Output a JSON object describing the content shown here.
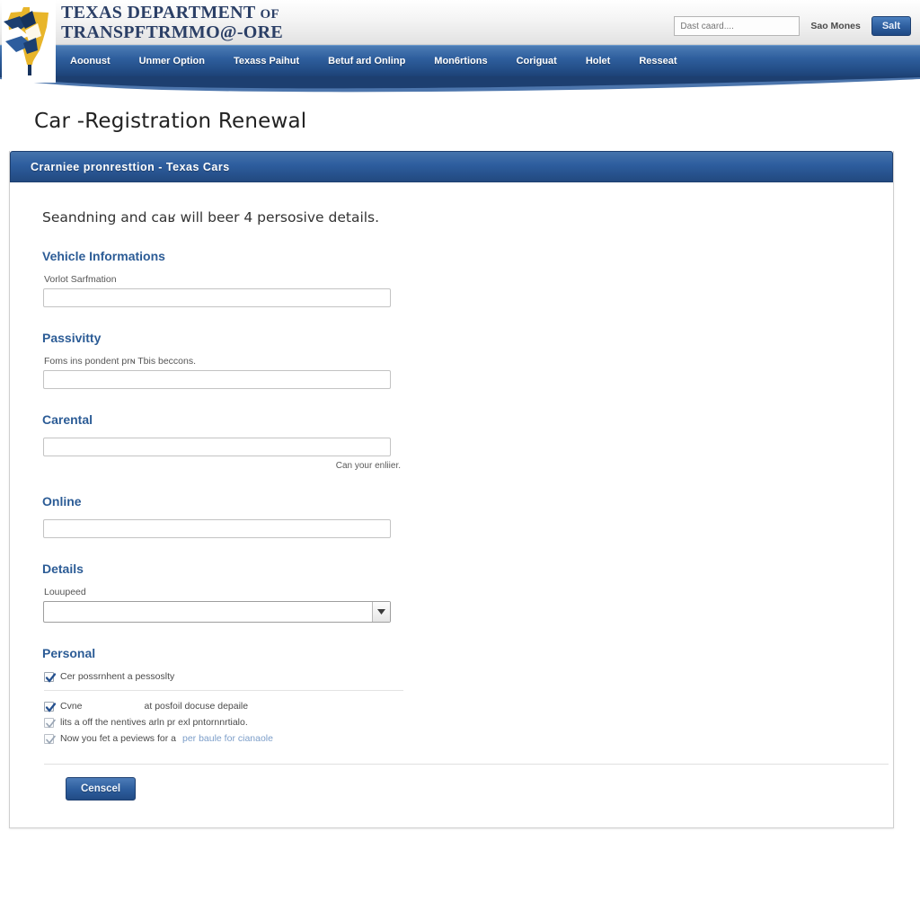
{
  "header": {
    "agency_line1_main": "TEXAS DEPARTMENT",
    "agency_line1_small": "OF",
    "agency_line2": "TRANSPFTRMMO@-ORE",
    "search_placeholder": "Dast caard....",
    "search_value": "",
    "account_link": "Sao Mones",
    "submit_button": "Salt"
  },
  "nav": {
    "items": [
      {
        "label": "Aoonust"
      },
      {
        "label": "Unmer Option"
      },
      {
        "label": "Texass Paihut"
      },
      {
        "label": "Betuf ard Onlinp"
      },
      {
        "label": "Mon6rtions"
      },
      {
        "label": "Coriguat"
      },
      {
        "label": "Holet"
      },
      {
        "label": "Resseat"
      }
    ]
  },
  "page": {
    "title": "Car -Registration Renewal"
  },
  "panel": {
    "heading": "Crarniee pronresttion - Texas Cars",
    "intro": "Seandning and caʁ will beer 4 persosive details.",
    "sections": [
      {
        "heading": "Vehicle Informations",
        "label": "Vorlot Sarfmation",
        "value": "",
        "hint": ""
      },
      {
        "heading": "Passivitty",
        "label": "Foms ins pondent prɴ Tbis beccons.",
        "value": "",
        "hint": ""
      },
      {
        "heading": "Carental",
        "label": "",
        "value": "",
        "hint": "Can your enliier."
      },
      {
        "heading": "Online",
        "label": "",
        "value": "",
        "hint": ""
      }
    ],
    "details": {
      "heading": "Details",
      "label": "Louupeed",
      "selected_value": ""
    },
    "personal": {
      "heading": "Personal",
      "checkboxes": [
        {
          "label": "Cer possrnhent a pessoslty",
          "checked": true,
          "style": "dark",
          "indent": false
        },
        {
          "label": "Cvne",
          "label2": "at posfoil docuse depaile",
          "checked": true,
          "style": "dark",
          "indent": true
        },
        {
          "label": "lits a off the nentives arln pr exl pntornnrtialo.",
          "checked": true,
          "style": "light",
          "indent": false
        },
        {
          "label": "Now you fet a peviews for a",
          "link": "per baule for cianaole",
          "checked": true,
          "style": "light",
          "indent": false
        }
      ]
    },
    "cancel_button": "Censcel"
  },
  "colors": {
    "brand_blue": "#2d5d9e",
    "nav_blue": "#244f89",
    "heading_blue": "#2c5c96",
    "link_blue": "#7c9ec9",
    "gold": "#e8b52a"
  }
}
